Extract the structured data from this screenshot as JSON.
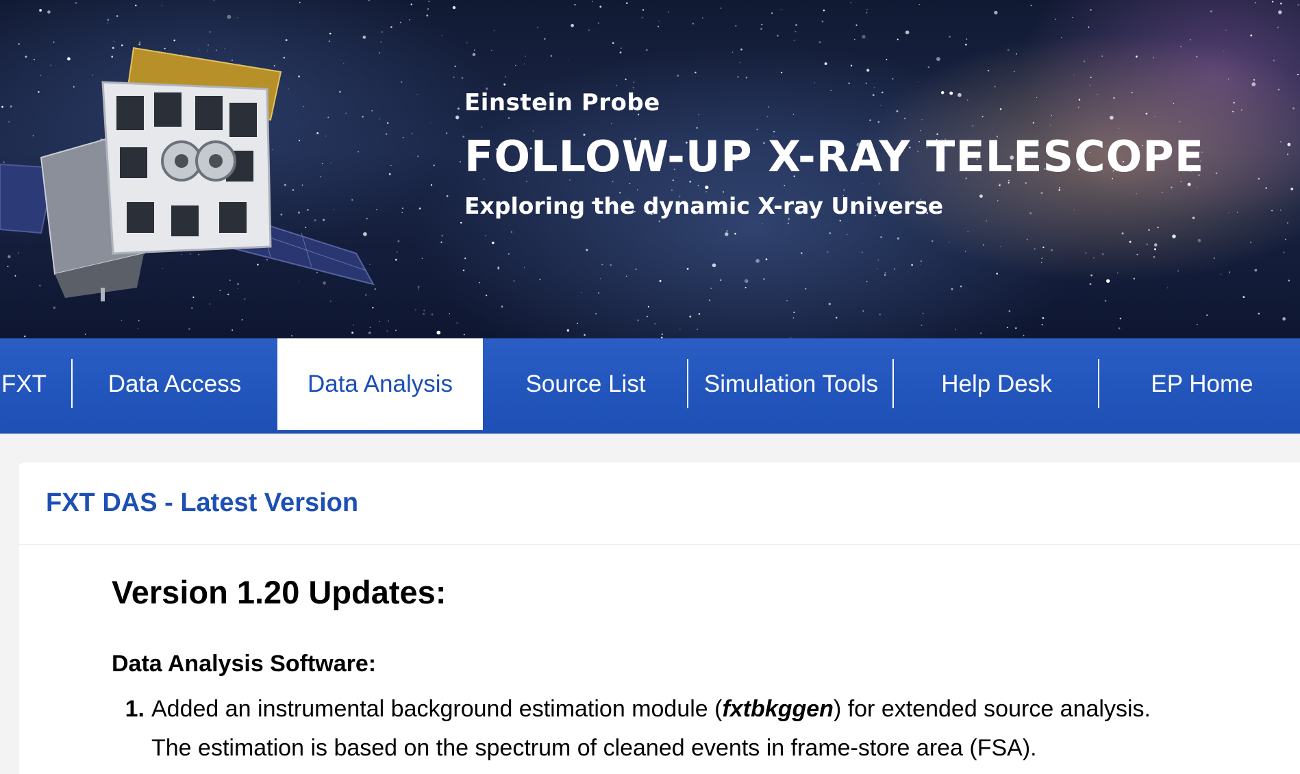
{
  "banner": {
    "kicker": "Einstein Probe",
    "title": "FOLLOW-UP X-RAY TELESCOPE",
    "tagline": "Exploring the dynamic X-ray Universe"
  },
  "nav": {
    "items": [
      {
        "label": "FXT",
        "active": false
      },
      {
        "label": "Data Access",
        "active": false
      },
      {
        "label": "Data Analysis",
        "active": true
      },
      {
        "label": "Source List",
        "active": false
      },
      {
        "label": "Simulation Tools",
        "active": false
      },
      {
        "label": "Help Desk",
        "active": false
      },
      {
        "label": "EP Home",
        "active": false
      }
    ]
  },
  "panel": {
    "title": "FXT DAS - Latest Version",
    "version_heading": "Version 1.20 Updates:",
    "section_heading": "Data Analysis Software:",
    "items": [
      {
        "number": "1.",
        "text_before": "Added an instrumental background estimation module (",
        "emphasis": "fxtbkggen",
        "text_after": ") for extended source analysis.",
        "text_line2": "The estimation is based on the spectrum of cleaned events in frame-store area (FSA)."
      }
    ]
  },
  "colors": {
    "nav_blue": "#1d4fb5",
    "active_tab_bg": "#ffffff",
    "title_blue": "#1d4fb5"
  }
}
